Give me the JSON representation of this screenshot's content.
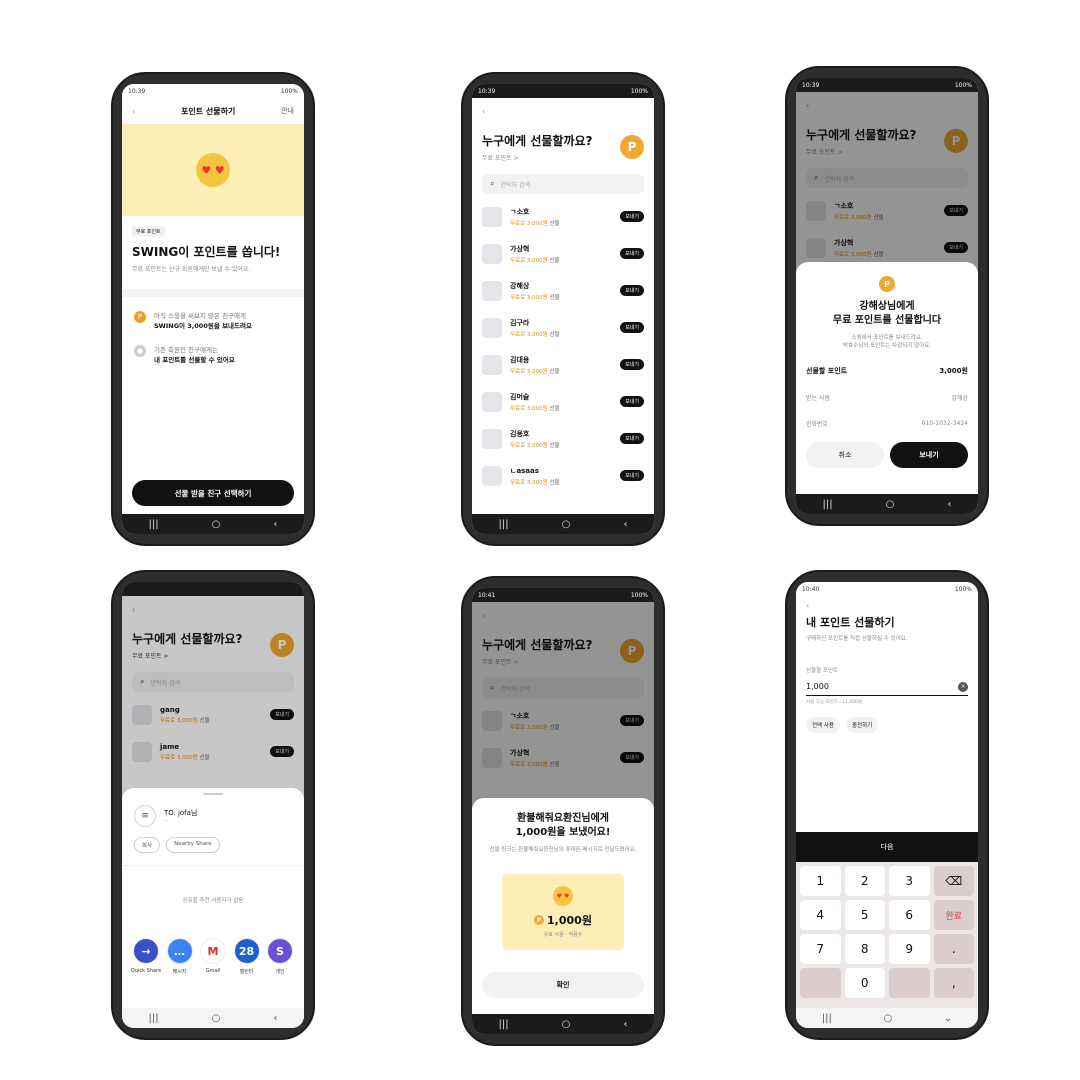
{
  "p1": {
    "status": {
      "time": "10:39",
      "right": "100%"
    },
    "header": {
      "title": "포인트 선물하기",
      "help": "안내"
    },
    "tag": "무료 포인트",
    "headline": "SWING이 포인트를 쏩니다!",
    "subtitle": "무료 포인트는 신규 회원에게만 보낼 수 있어요.",
    "info1": {
      "line1": "아직 스윙을 써보지 않은 친구에게",
      "line2": "SWING이 3,000원을 보내드려요"
    },
    "info2": {
      "line1": "기존 회원인 친구에게는",
      "line2": "내 포인트를 선물할 수 있어요"
    },
    "cta": "선물 받을 친구 선택하기"
  },
  "p2": {
    "status": {
      "time": "10:39",
      "right": "100%"
    },
    "question": "누구에게 선물할까요?",
    "sub": "무료 포인트 >",
    "coin": "P",
    "search_placeholder": "연락처 검색",
    "send_label": "보내기",
    "point_text": "무료로 3,000원",
    "point_suffix": "선물",
    "contacts": [
      "ㄱ소호",
      "가상혁",
      "강해상",
      "김구라",
      "김대용",
      "김머슬",
      "김용호",
      "ㄴasaas"
    ]
  },
  "p3": {
    "status": {
      "time": "10:39",
      "right": "100%"
    },
    "contacts": [
      "ㄱ소호",
      "가상혁"
    ],
    "coin": "P",
    "title1": "강해상님에게",
    "title2": "무료 포인트를 선물합니다",
    "desc1": "스윙에서 포인트를 보내드려요.",
    "desc2": "박효수님의 포인트는 차감되지 않아요.",
    "rows": [
      {
        "k": "선물할 포인트",
        "v": "3,000원"
      },
      {
        "k": "받는 사람",
        "v": "강해상"
      },
      {
        "k": "전화번호",
        "v": "010-1032-3424"
      }
    ],
    "cancel": "취소",
    "send": "보내기"
  },
  "p4": {
    "question": "누구에게 선물할까요?",
    "sub": "무료 포인트 >",
    "coin": "P",
    "search_placeholder": "연락처 검색",
    "contacts": [
      "gang",
      "jame"
    ],
    "to": "TO. jofa님",
    "to_sub": "--",
    "chip1": "복사",
    "chip2": "Nearby Share",
    "empty": "공유할 추천 사용자가 없음",
    "apps": [
      {
        "label": "Quick Share",
        "color": "#3a4fc9",
        "glyph": "→"
      },
      {
        "label": "메시지",
        "color": "#3b82f6",
        "glyph": "…"
      },
      {
        "label": "Gmail",
        "color": "#ffffff",
        "glyph": "M"
      },
      {
        "label": "캘린더",
        "color": "#1f5fd0",
        "glyph": "28"
      },
      {
        "label": "개인",
        "color": "#6b4fd6",
        "glyph": "S"
      }
    ]
  },
  "p5": {
    "status": {
      "time": "10:41",
      "right": "100%"
    },
    "question": "누구에게 선물할까요?",
    "sub": "무료 포인트 >",
    "coin": "P",
    "search_placeholder": "연락처 검색",
    "contacts": [
      "ㄱ소호",
      "가상혁"
    ],
    "title1": "환불해줘요환진님에게",
    "title2": "1,000원을 보냈어요!",
    "desc": "선물 링크는 환불해줘요환진님의 휴대폰 메시지로 전달드렸어요.",
    "amount": "1,000원",
    "caption": "유효 사용 · 적용수",
    "ok": "확인"
  },
  "p6": {
    "status": {
      "time": "10:40",
      "right": "100%"
    },
    "title": "내 포인트 선물하기",
    "sub": "구매하신 포인트를 직접 선물하실 수 있어요.",
    "label": "선물할 포인트",
    "value": "1,000",
    "hint": "사용 가능 포인트 : 11,000원",
    "btn1": "전액 사용",
    "btn2": "충전하기",
    "next": "다음",
    "keys": [
      "1",
      "2",
      "3",
      "⌫",
      "4",
      "5",
      "6",
      "완료",
      "7",
      "8",
      "9",
      ".",
      "",
      "0",
      "",
      ","
    ]
  }
}
